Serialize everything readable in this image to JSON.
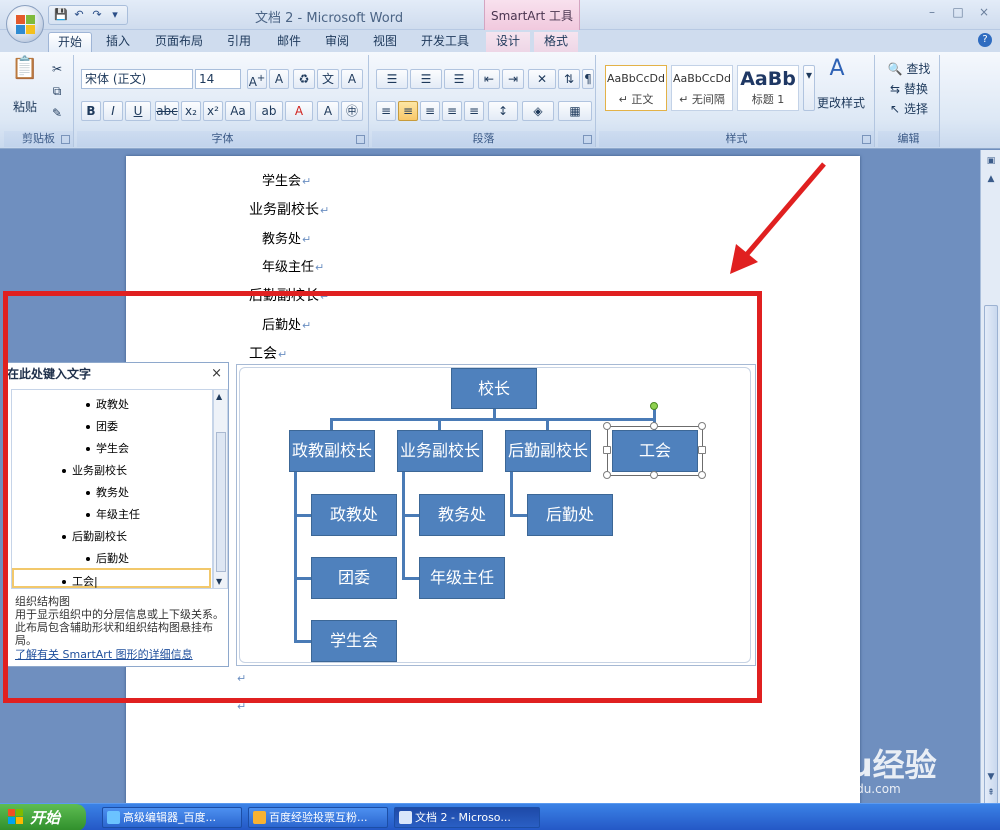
{
  "window": {
    "title": "文档 2 - Microsoft Word",
    "context_tab_group": "SmartArt 工具",
    "controls": [
      "–",
      "□",
      "×"
    ]
  },
  "quick_access": [
    "save",
    "undo",
    "redo",
    "customize"
  ],
  "tabs": [
    "开始",
    "插入",
    "页面布局",
    "引用",
    "邮件",
    "审阅",
    "视图",
    "开发工具",
    "设计",
    "格式"
  ],
  "ribbon": {
    "clipboard": {
      "paste": "粘贴",
      "label": "剪贴板"
    },
    "font": {
      "name": "宋体 (正文)",
      "size": "14",
      "label": "字体"
    },
    "paragraph": {
      "label": "段落"
    },
    "styles": {
      "items": [
        {
          "preview": "AaBbCcDd",
          "label": "↵ 正文"
        },
        {
          "preview": "AaBbCcDd",
          "label": "↵ 无间隔"
        },
        {
          "preview": "AaBb",
          "label": "标题 1"
        }
      ],
      "change": "更改样式",
      "label": "样式"
    },
    "editing": {
      "find": "查找",
      "replace": "替换",
      "select": "选择",
      "label": "编辑"
    }
  },
  "document": {
    "lines": [
      "学生会",
      "业务副校长",
      "教务处",
      "年级主任",
      "后勤副校长",
      "后勤处",
      "工会"
    ]
  },
  "text_pane": {
    "title": "在此处键入文字",
    "close": "×",
    "items": [
      {
        "text": "政教处",
        "level": 2
      },
      {
        "text": "团委",
        "level": 2
      },
      {
        "text": "学生会",
        "level": 2
      },
      {
        "text": "业务副校长",
        "level": 1
      },
      {
        "text": "教务处",
        "level": 2
      },
      {
        "text": "年级主任",
        "level": 2
      },
      {
        "text": "后勤副校长",
        "level": 1
      },
      {
        "text": "后勤处",
        "level": 2
      },
      {
        "text": "工会",
        "level": 1
      }
    ],
    "desc_title": "组织结构图",
    "desc_body": "用于显示组织中的分层信息或上下级关系。此布局包含辅助形状和组织结构图悬挂布局。",
    "link": "了解有关 SmartArt 图形的详细信息"
  },
  "org_chart": {
    "root": "校长",
    "deputies": [
      "政教副校长",
      "业务副校长",
      "后勤副校长",
      "工会"
    ],
    "subs_1": [
      "政教处",
      "团委",
      "学生会"
    ],
    "subs_2": [
      "教务处",
      "年级主任"
    ],
    "subs_3": [
      "后勤处"
    ]
  },
  "taskbar": {
    "start": "开始",
    "tasks": [
      "高级编辑器_百度...",
      "百度经验投票互粉...",
      "文档 2 - Microso..."
    ]
  },
  "watermark": {
    "main": "Baidu经验",
    "sub": "jingyan.baidu.com"
  },
  "colors": {
    "node_fill": "#4f81bd",
    "annotation": "#e02020"
  }
}
